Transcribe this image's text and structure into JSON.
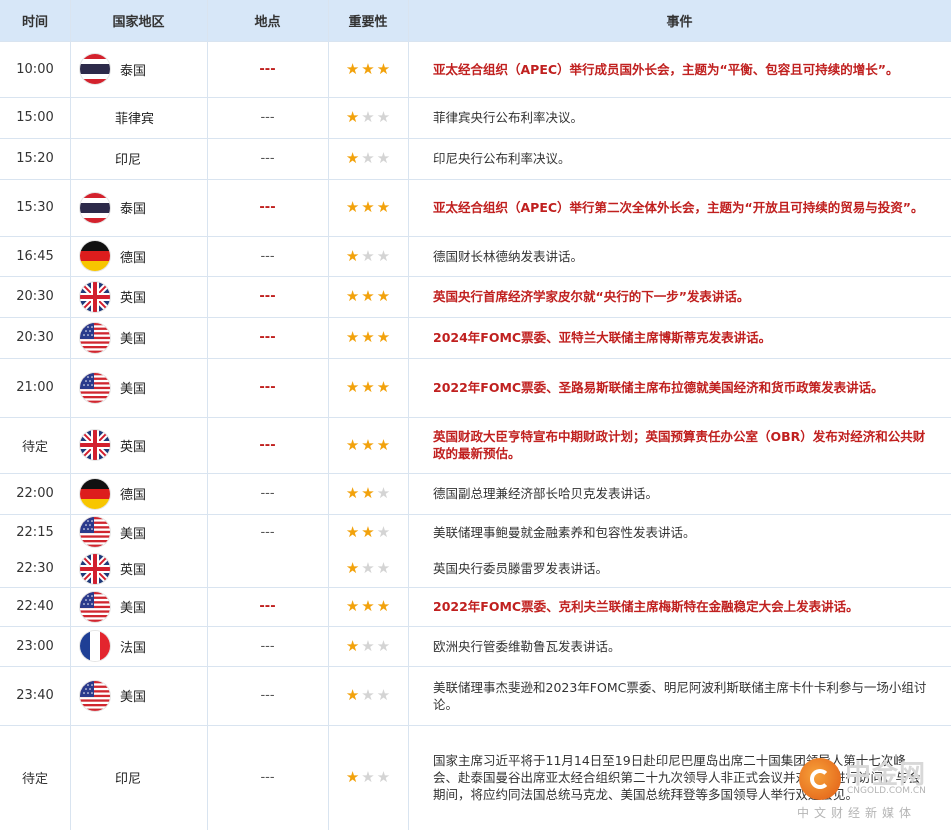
{
  "header": {
    "time": "时间",
    "country": "国家地区",
    "location": "地点",
    "importance": "重要性",
    "event": "事件"
  },
  "colors": {
    "header_bg": "#d7e7f8",
    "highlight_text": "#c0201f",
    "star_on": "#f2a20c",
    "star_off": "#d4d4d4",
    "grid_line": "#d9e4f0"
  },
  "rows": [
    {
      "time": "10:00",
      "country": "泰国",
      "flag": "thailand-flag-icon",
      "location": "---",
      "stars": 3,
      "event": "亚太经合组织（APEC）举行成员国外长会，主题为“平衡、包容且可持续的增长”。"
    },
    {
      "time": "15:00",
      "country": "菲律宾",
      "flag": "",
      "location": "---",
      "stars": 1,
      "event": "菲律宾央行公布利率决议。"
    },
    {
      "time": "15:20",
      "country": "印尼",
      "flag": "",
      "location": "---",
      "stars": 1,
      "event": "印尼央行公布利率决议。"
    },
    {
      "time": "15:30",
      "country": "泰国",
      "flag": "thailand-flag-icon",
      "location": "---",
      "stars": 3,
      "event": "亚太经合组织（APEC）举行第二次全体外长会，主题为“开放且可持续的贸易与投资”。"
    },
    {
      "time": "16:45",
      "country": "德国",
      "flag": "germany-flag-icon",
      "location": "---",
      "stars": 1,
      "event": "德国财长林德纳发表讲话。"
    },
    {
      "time": "20:30",
      "country": "英国",
      "flag": "uk-flag-icon",
      "location": "---",
      "stars": 3,
      "event": "英国央行首席经济学家皮尔就“央行的下一步”发表讲话。"
    },
    {
      "time": "20:30",
      "country": "美国",
      "flag": "usa-flag-icon",
      "location": "---",
      "stars": 3,
      "event": "2024年FOMC票委、亚特兰大联储主席博斯蒂克发表讲话。"
    },
    {
      "time": "21:00",
      "country": "美国",
      "flag": "usa-flag-icon",
      "location": "---",
      "stars": 3,
      "event": "2022年FOMC票委、圣路易斯联储主席布拉德就美国经济和货币政策发表讲话。"
    },
    {
      "time": "待定",
      "country": "英国",
      "flag": "uk-flag-icon",
      "location": "---",
      "stars": 3,
      "event": "英国财政大臣亨特宣布中期财政计划；英国预算责任办公室（OBR）发布对经济和公共财政的最新预估。"
    },
    {
      "time": "22:00",
      "country": "德国",
      "flag": "germany-flag-icon",
      "location": "---",
      "stars": 2,
      "event": "德国副总理兼经济部长哈贝克发表讲话。"
    },
    {
      "time": "22:15",
      "country": "美国",
      "flag": "usa-flag-icon",
      "location": "---",
      "stars": 2,
      "event": "美联储理事鲍曼就金融素养和包容性发表讲话。"
    },
    {
      "time": "22:30",
      "country": "英国",
      "flag": "uk-flag-icon",
      "location": "",
      "stars": 1,
      "event": "英国央行委员滕雷罗发表讲话。"
    },
    {
      "time": "22:40",
      "country": "美国",
      "flag": "usa-flag-icon",
      "location": "---",
      "stars": 3,
      "event": "2022年FOMC票委、克利夫兰联储主席梅斯特在金融稳定大会上发表讲话。"
    },
    {
      "time": "23:00",
      "country": "法国",
      "flag": "france-flag-icon",
      "location": "---",
      "stars": 1,
      "event": "欧洲央行管委维勒鲁瓦发表讲话。"
    },
    {
      "time": "23:40",
      "country": "美国",
      "flag": "usa-flag-icon",
      "location": "---",
      "stars": 1,
      "event": "美联储理事杰斐逊和2023年FOMC票委、明尼阿波利斯联储主席卡什卡利参与一场小组讨论。"
    },
    {
      "time": "待定",
      "country": "印尼",
      "flag": "",
      "location": "---",
      "stars": 1,
      "event": "国家主席习近平将于11月14日至19日赴印尼巴厘岛出席二十国集团领导人第十七次峰会、赴泰国曼谷出席亚太经合组织第二十九次领导人非正式会议并对泰国进行访问。与会期间，将应约同法国总统马克龙、美国总统拜登等多国领导人举行双边会见。"
    }
  ],
  "watermark": {
    "main": "中金网",
    "url": "CNGOLD.COM.CN",
    "sub": "中文财经新媒体"
  }
}
